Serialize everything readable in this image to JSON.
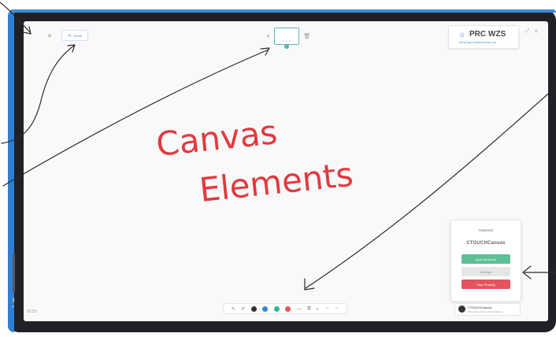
{
  "topbar": {
    "menu_icon": "hamburger-menu-icon",
    "share_label": "Share"
  },
  "page_nav": {
    "plus": "+",
    "trash_icon": "trash-icon"
  },
  "session": {
    "title": "PRC WZS",
    "subtitle": "Join at app.flowthecanvas.com"
  },
  "window_controls": {
    "expand": "⤢",
    "close": "✕"
  },
  "toolbar": {
    "colors": [
      "#333333",
      "#3a86d4",
      "#2fb79a",
      "#e3545c"
    ],
    "undo": "↶",
    "redo": "↷"
  },
  "airserver": {
    "heading": "AirServer",
    "brand": "CTOUCHCanvas",
    "open_label": "Open AirServer",
    "settings_label": "Settings",
    "stop_label": "Stop Sharing"
  },
  "airserver_connect": {
    "name": "CTOUCHCanvas",
    "subtitle": "Wirelessly connect with AirServer"
  },
  "clock": "15:53",
  "annotation": {
    "line1": "Canvas",
    "line2": "Elements",
    "ink_color": "#e03a3f"
  }
}
